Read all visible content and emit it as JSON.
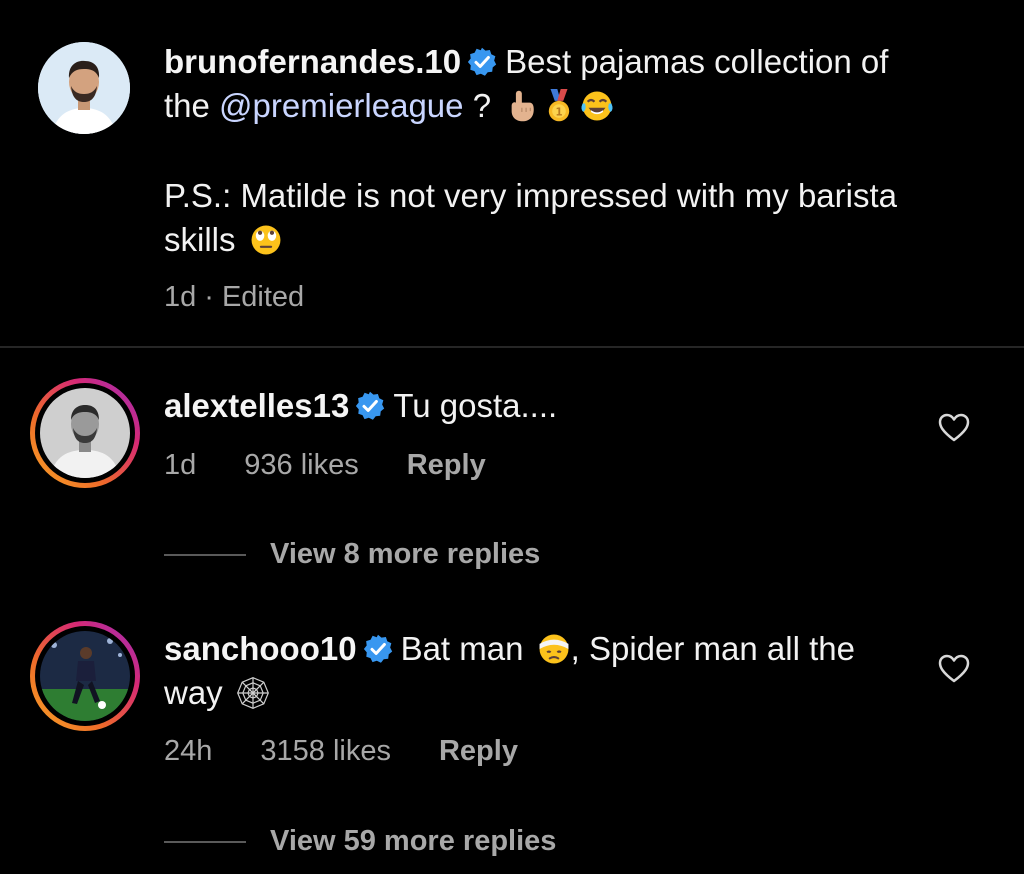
{
  "caption": {
    "username": "brunofernandes.10",
    "text_part1": "Best pajamas collection of the",
    "mention": "@premierleague",
    "text_part2": "?",
    "ps_text": "P.S.: Matilde is not very impressed with my barista skills",
    "time": "1d",
    "separator": "·",
    "edited": "Edited",
    "emojis": [
      "pointing-up-hand-icon",
      "gold-medal-icon",
      "tears-of-joy-icon",
      "eye-roll-face-icon"
    ]
  },
  "comments": [
    {
      "username": "alextelles13",
      "text": "Tu gosta....",
      "time": "1d",
      "likes": "936 likes",
      "reply": "Reply",
      "view_replies": "View 8 more replies"
    },
    {
      "username": "sanchooo10",
      "text_part1": "Bat man",
      "text_part2": ", Spider man all the way",
      "time": "24h",
      "likes": "3158 likes",
      "reply": "Reply",
      "view_replies": "View 59 more replies",
      "emojis": [
        "bandaged-face-icon",
        "spider-web-icon"
      ]
    }
  ],
  "colors": {
    "background": "#000000",
    "verified_badge": "#3897f0",
    "mention": "#c9d5ff",
    "meta_text": "#a8a8a8"
  }
}
